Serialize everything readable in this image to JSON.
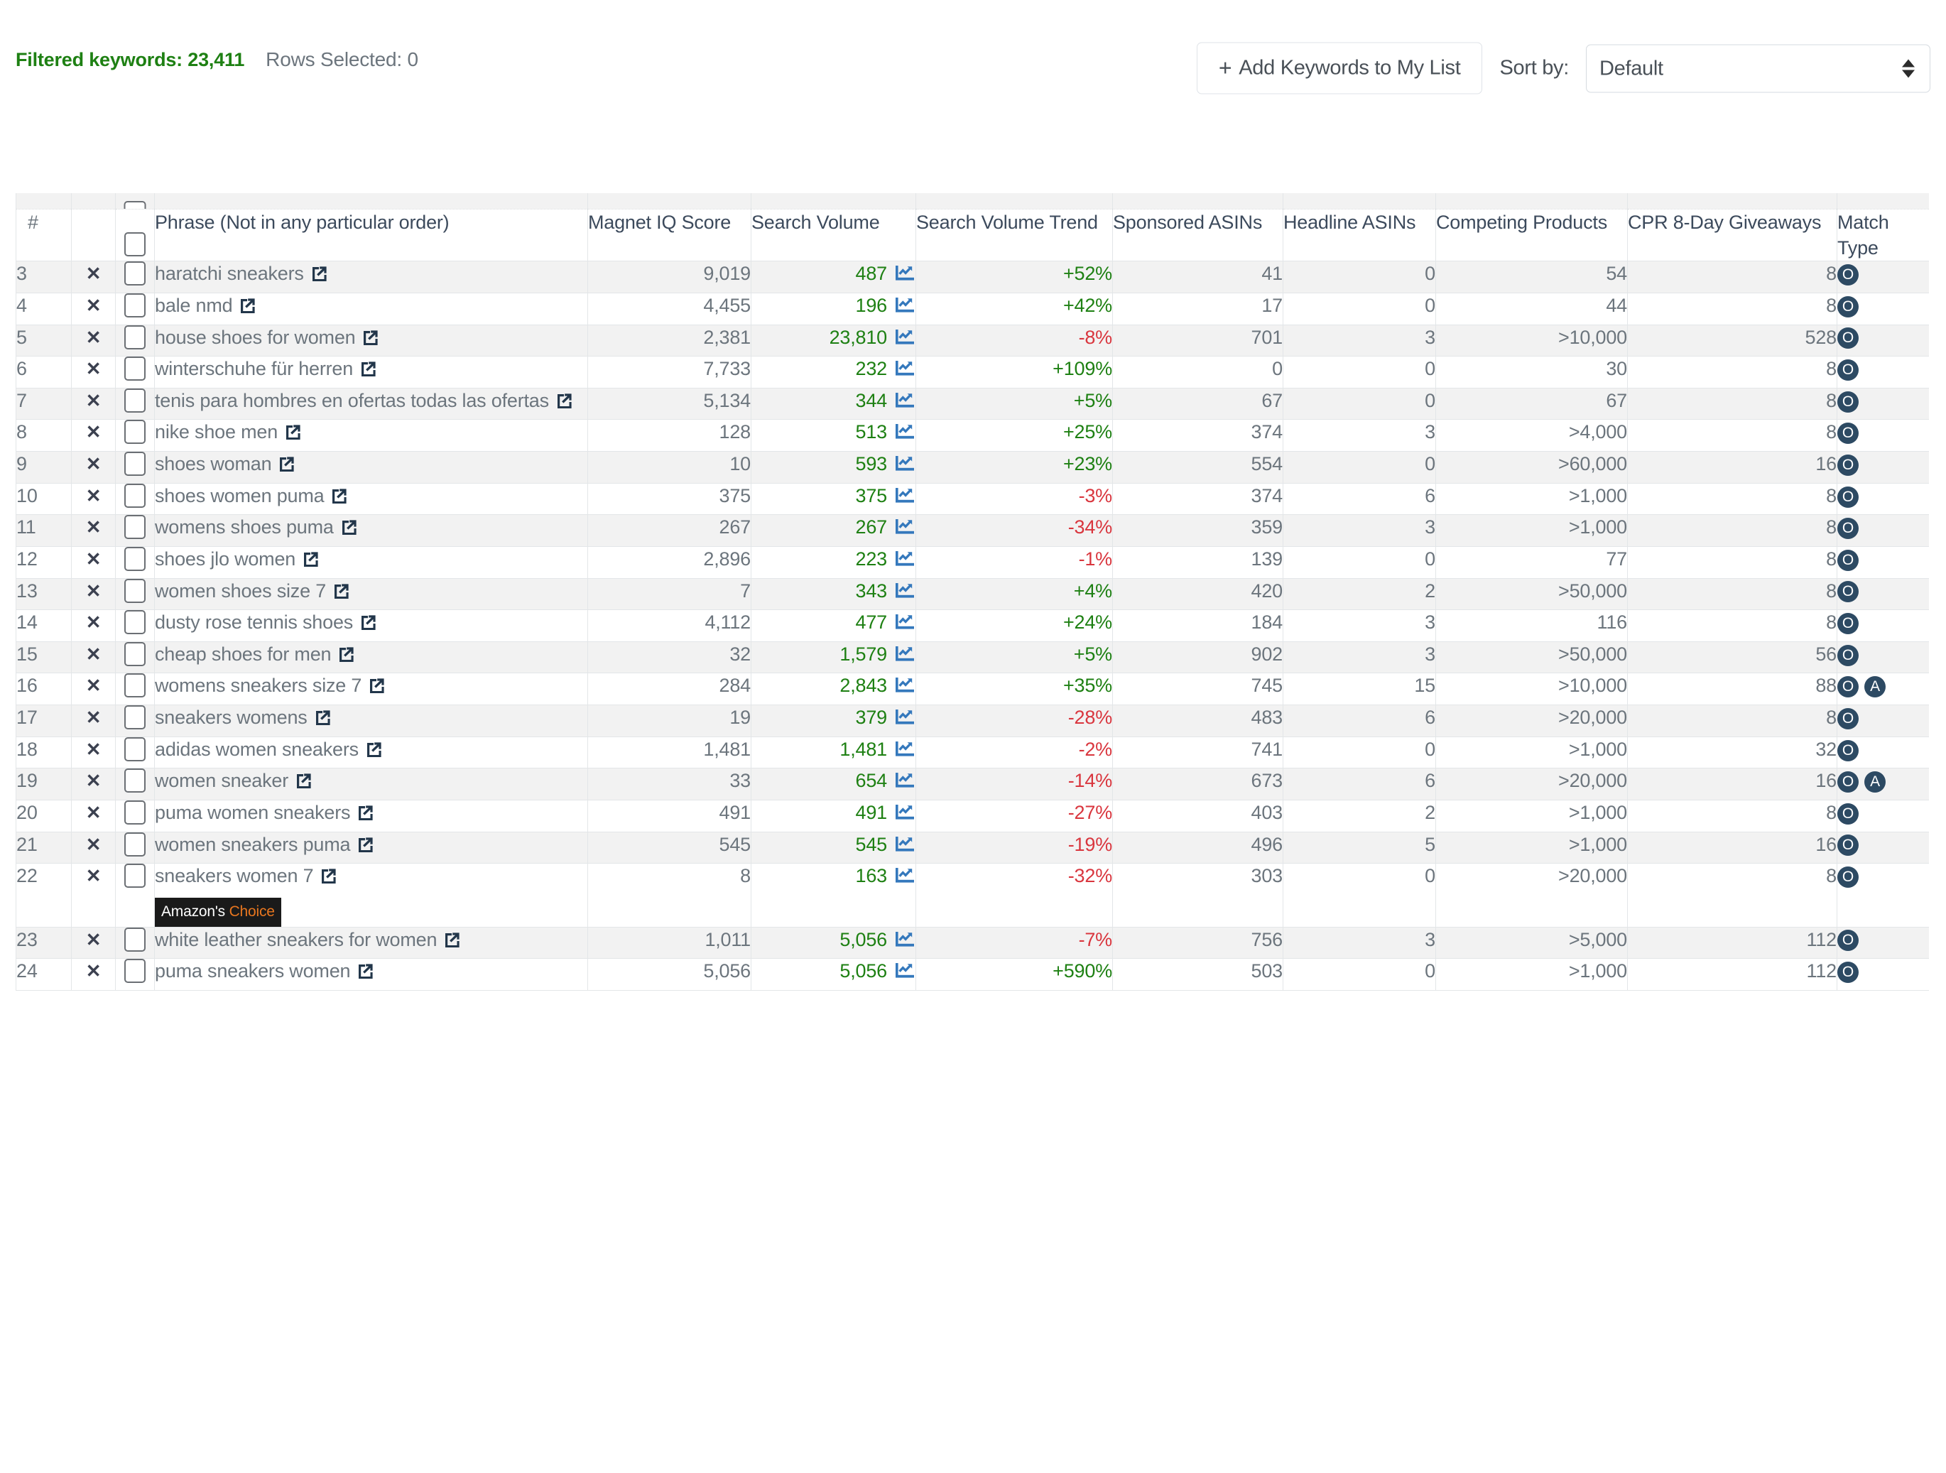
{
  "toolbar": {
    "filtered_keywords_label": "Filtered keywords: 23,411",
    "rows_selected_label": "Rows Selected: 0",
    "add_keywords_label": "Add Keywords to My List",
    "add_keywords_plus": "+",
    "sort_by_label": "Sort by:",
    "sort_selected": "Default",
    "sort_options": [
      "Default"
    ]
  },
  "colors": {
    "accent_green": "#1e8013",
    "negative_red": "#d9363e",
    "badge_navy": "#2d4a63",
    "amazon_orange": "#e8761f",
    "trend_icon_blue": "#3478bc"
  },
  "table": {
    "columns": [
      "#",
      "",
      "",
      "Phrase (Not in any particular order)",
      "Magnet IQ Score",
      "Search Volume",
      "Search Volume Trend",
      "Sponsored ASINs",
      "Headline ASINs",
      "Competing Products",
      "CPR 8-Day Giveaways",
      "Match Type"
    ],
    "remove_glyph": "✕",
    "rows": [
      {
        "n": "3",
        "phrase": "haratchi sneakers",
        "miq": "9,019",
        "sv": "487",
        "svt": "+52%",
        "svt_dir": "up",
        "spon": "41",
        "head": "0",
        "comp": "54",
        "cpr": "8",
        "match": [
          "O"
        ],
        "badge": null
      },
      {
        "n": "4",
        "phrase": "bale nmd",
        "miq": "4,455",
        "sv": "196",
        "svt": "+42%",
        "svt_dir": "up",
        "spon": "17",
        "head": "0",
        "comp": "44",
        "cpr": "8",
        "match": [
          "O"
        ],
        "badge": null
      },
      {
        "n": "5",
        "phrase": "house shoes for women",
        "miq": "2,381",
        "sv": "23,810",
        "svt": "-8%",
        "svt_dir": "down",
        "spon": "701",
        "head": "3",
        "comp": ">10,000",
        "cpr": "528",
        "match": [
          "O"
        ],
        "badge": null
      },
      {
        "n": "6",
        "phrase": "winterschuhe für herren",
        "miq": "7,733",
        "sv": "232",
        "svt": "+109%",
        "svt_dir": "up",
        "spon": "0",
        "head": "0",
        "comp": "30",
        "cpr": "8",
        "match": [
          "O"
        ],
        "badge": null
      },
      {
        "n": "7",
        "phrase": "tenis para hombres en ofertas todas las ofertas",
        "miq": "5,134",
        "sv": "344",
        "svt": "+5%",
        "svt_dir": "up",
        "spon": "67",
        "head": "0",
        "comp": "67",
        "cpr": "8",
        "match": [
          "O"
        ],
        "badge": null
      },
      {
        "n": "8",
        "phrase": "nike shoe men",
        "miq": "128",
        "sv": "513",
        "svt": "+25%",
        "svt_dir": "up",
        "spon": "374",
        "head": "3",
        "comp": ">4,000",
        "cpr": "8",
        "match": [
          "O"
        ],
        "badge": null
      },
      {
        "n": "9",
        "phrase": "shoes woman",
        "miq": "10",
        "sv": "593",
        "svt": "+23%",
        "svt_dir": "up",
        "spon": "554",
        "head": "0",
        "comp": ">60,000",
        "cpr": "16",
        "match": [
          "O"
        ],
        "badge": null
      },
      {
        "n": "10",
        "phrase": "shoes women puma",
        "miq": "375",
        "sv": "375",
        "svt": "-3%",
        "svt_dir": "down",
        "spon": "374",
        "head": "6",
        "comp": ">1,000",
        "cpr": "8",
        "match": [
          "O"
        ],
        "badge": null
      },
      {
        "n": "11",
        "phrase": "womens shoes puma",
        "miq": "267",
        "sv": "267",
        "svt": "-34%",
        "svt_dir": "down",
        "spon": "359",
        "head": "3",
        "comp": ">1,000",
        "cpr": "8",
        "match": [
          "O"
        ],
        "badge": null
      },
      {
        "n": "12",
        "phrase": "shoes jlo women",
        "miq": "2,896",
        "sv": "223",
        "svt": "-1%",
        "svt_dir": "down",
        "spon": "139",
        "head": "0",
        "comp": "77",
        "cpr": "8",
        "match": [
          "O"
        ],
        "badge": null
      },
      {
        "n": "13",
        "phrase": "women shoes size 7",
        "miq": "7",
        "sv": "343",
        "svt": "+4%",
        "svt_dir": "up",
        "spon": "420",
        "head": "2",
        "comp": ">50,000",
        "cpr": "8",
        "match": [
          "O"
        ],
        "badge": null
      },
      {
        "n": "14",
        "phrase": "dusty rose tennis shoes",
        "miq": "4,112",
        "sv": "477",
        "svt": "+24%",
        "svt_dir": "up",
        "spon": "184",
        "head": "3",
        "comp": "116",
        "cpr": "8",
        "match": [
          "O"
        ],
        "badge": null
      },
      {
        "n": "15",
        "phrase": "cheap shoes for men",
        "miq": "32",
        "sv": "1,579",
        "svt": "+5%",
        "svt_dir": "up",
        "spon": "902",
        "head": "3",
        "comp": ">50,000",
        "cpr": "56",
        "match": [
          "O"
        ],
        "badge": null
      },
      {
        "n": "16",
        "phrase": "womens sneakers size 7",
        "miq": "284",
        "sv": "2,843",
        "svt": "+35%",
        "svt_dir": "up",
        "spon": "745",
        "head": "15",
        "comp": ">10,000",
        "cpr": "88",
        "match": [
          "O",
          "A"
        ],
        "badge": null
      },
      {
        "n": "17",
        "phrase": "sneakers womens",
        "miq": "19",
        "sv": "379",
        "svt": "-28%",
        "svt_dir": "down",
        "spon": "483",
        "head": "6",
        "comp": ">20,000",
        "cpr": "8",
        "match": [
          "O"
        ],
        "badge": null
      },
      {
        "n": "18",
        "phrase": "adidas women sneakers",
        "miq": "1,481",
        "sv": "1,481",
        "svt": "-2%",
        "svt_dir": "down",
        "spon": "741",
        "head": "0",
        "comp": ">1,000",
        "cpr": "32",
        "match": [
          "O"
        ],
        "badge": null
      },
      {
        "n": "19",
        "phrase": "women sneaker",
        "miq": "33",
        "sv": "654",
        "svt": "-14%",
        "svt_dir": "down",
        "spon": "673",
        "head": "6",
        "comp": ">20,000",
        "cpr": "16",
        "match": [
          "O",
          "A"
        ],
        "badge": null
      },
      {
        "n": "20",
        "phrase": "puma women sneakers",
        "miq": "491",
        "sv": "491",
        "svt": "-27%",
        "svt_dir": "down",
        "spon": "403",
        "head": "2",
        "comp": ">1,000",
        "cpr": "8",
        "match": [
          "O"
        ],
        "badge": null
      },
      {
        "n": "21",
        "phrase": "women sneakers puma",
        "miq": "545",
        "sv": "545",
        "svt": "-19%",
        "svt_dir": "down",
        "spon": "496",
        "head": "5",
        "comp": ">1,000",
        "cpr": "16",
        "match": [
          "O"
        ],
        "badge": null
      },
      {
        "n": "22",
        "phrase": "sneakers women 7",
        "miq": "8",
        "sv": "163",
        "svt": "-32%",
        "svt_dir": "down",
        "spon": "303",
        "head": "0",
        "comp": ">20,000",
        "cpr": "8",
        "match": [
          "O"
        ],
        "badge": {
          "prefix": "Amazon's",
          "suffix": "Choice"
        }
      },
      {
        "n": "23",
        "phrase": "white leather sneakers for women",
        "miq": "1,011",
        "sv": "5,056",
        "svt": "-7%",
        "svt_dir": "down",
        "spon": "756",
        "head": "3",
        "comp": ">5,000",
        "cpr": "112",
        "match": [
          "O"
        ],
        "badge": null
      },
      {
        "n": "24",
        "phrase": "puma sneakers women",
        "miq": "5,056",
        "sv": "5,056",
        "svt": "+590%",
        "svt_dir": "up",
        "spon": "503",
        "head": "0",
        "comp": ">1,000",
        "cpr": "112",
        "match": [
          "O"
        ],
        "badge": null
      }
    ]
  }
}
